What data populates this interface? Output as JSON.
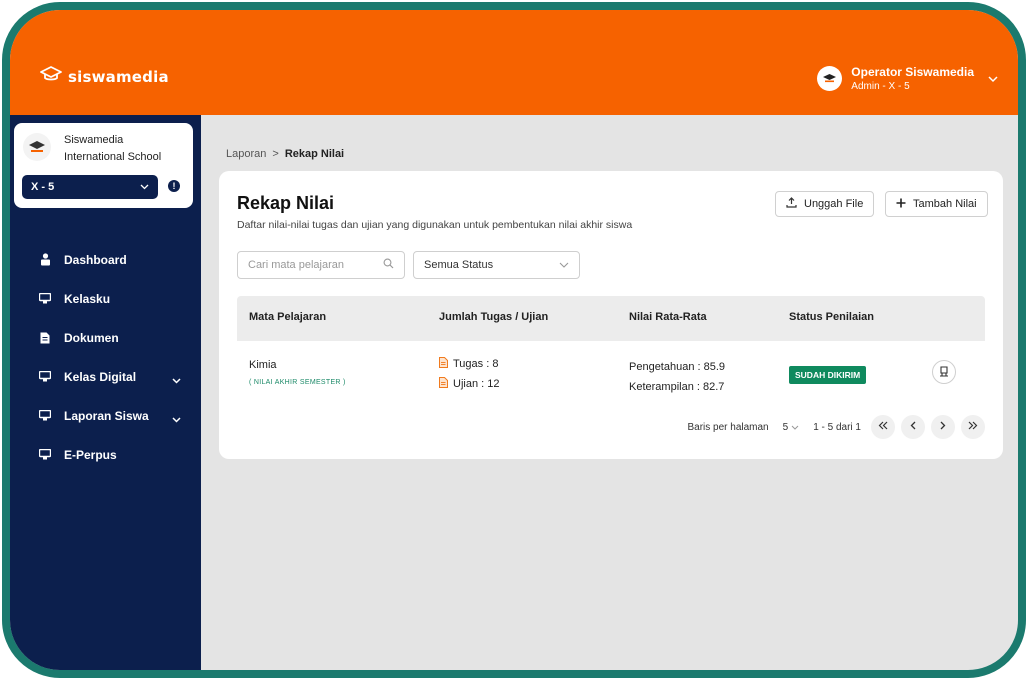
{
  "brand": {
    "name": "siswamedia",
    "icon": "graduation-cap-icon"
  },
  "user": {
    "name": "Operator Siswamedia",
    "role": "Admin - X - 5"
  },
  "school": {
    "name": "Siswamedia International School",
    "class_selected": "X - 5",
    "info": "!"
  },
  "sidebar": {
    "items": [
      {
        "label": "Dashboard",
        "icon": "user-icon",
        "has_submenu": false
      },
      {
        "label": "Kelasku",
        "icon": "monitor-icon",
        "has_submenu": false
      },
      {
        "label": "Dokumen",
        "icon": "document-icon",
        "has_submenu": false
      },
      {
        "label": "Kelas Digital",
        "icon": "monitor-icon",
        "has_submenu": true
      },
      {
        "label": "Laporan Siswa",
        "icon": "monitor-icon",
        "has_submenu": true
      },
      {
        "label": "E-Perpus",
        "icon": "monitor-icon",
        "has_submenu": false
      }
    ]
  },
  "breadcrumb": {
    "parent": "Laporan",
    "separator": ">",
    "current": "Rekap Nilai"
  },
  "page": {
    "title": "Rekap Nilai",
    "subtitle": "Daftar nilai-nilai tugas dan ujian yang digunakan untuk pembentukan nilai akhir siswa",
    "upload_label": "Unggah File",
    "add_label": "Tambah Nilai"
  },
  "filters": {
    "search_placeholder": "Cari mata pelajaran",
    "status_selected": "Semua Status"
  },
  "table": {
    "columns": [
      "Mata Pelajaran",
      "Jumlah Tugas / Ujian",
      "Nilai Rata-Rata",
      "Status Penilaian"
    ],
    "rows": [
      {
        "subject": "Kimia",
        "tag": "( NILAI AKHIR SEMESTER )",
        "tugas": "Tugas : 8",
        "ujian": "Ujian : 12",
        "pengetahuan": "Pengetahuan : 85.9",
        "keterampilan": "Keterampilan : 82.7",
        "status": "SUDAH DIKIRIM"
      }
    ]
  },
  "pagination": {
    "rows_label": "Baris per halaman",
    "rows_value": "5",
    "range": "1 - 5 dari 1"
  },
  "colors": {
    "brand_orange": "#f66200",
    "sidebar_navy": "#0c1f4d",
    "status_green": "#0f8a5e",
    "frame_teal": "#1b7a6e"
  }
}
